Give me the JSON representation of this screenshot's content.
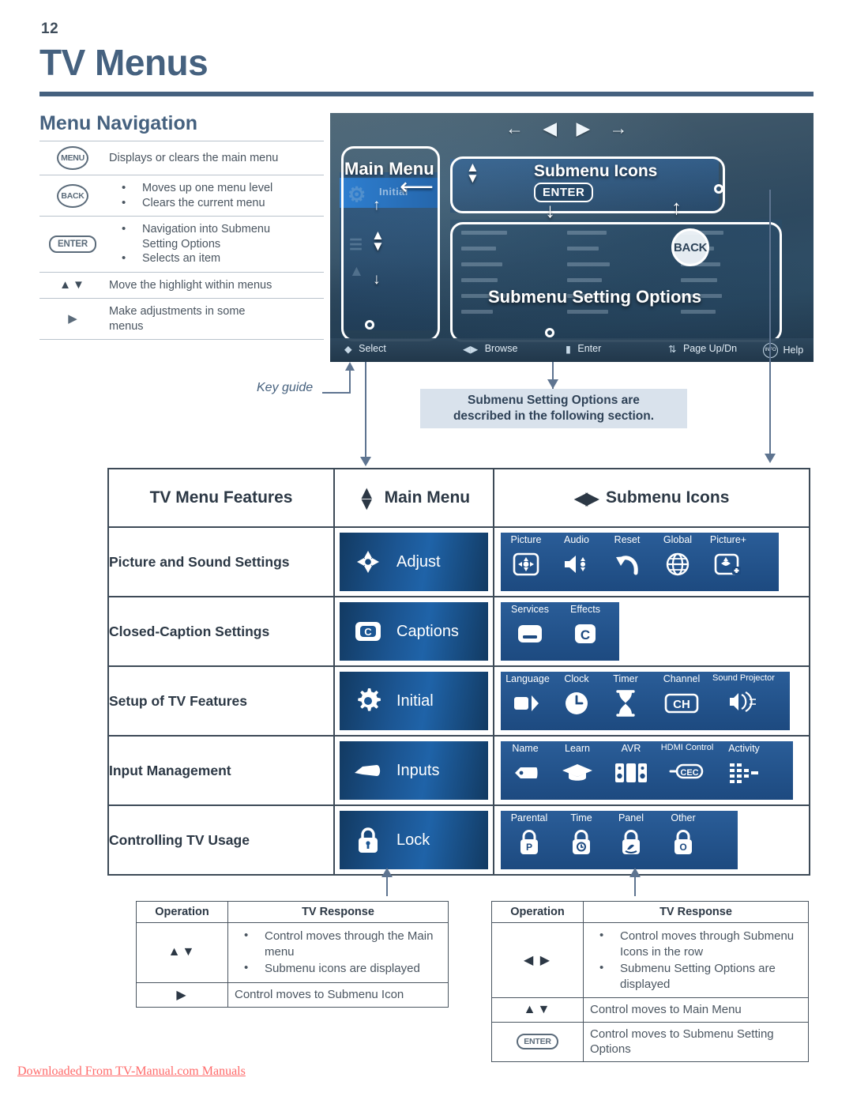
{
  "page": {
    "number": "12",
    "title": "TV Menus"
  },
  "nav": {
    "heading": "Menu Navigation",
    "rows": [
      {
        "key": "MENU",
        "key_type": "round",
        "lines": [
          "Displays or clears the main menu"
        ],
        "bulleted": false
      },
      {
        "key": "BACK",
        "key_type": "round",
        "lines": [
          "Moves up one menu level",
          "Clears the current menu"
        ],
        "bulleted": true
      },
      {
        "key": "ENTER",
        "key_type": "pill",
        "lines": [
          "Navigation into Submenu",
          "Setting Options",
          "Selects an item"
        ],
        "bulleted": true
      },
      {
        "key": "▲▼",
        "key_type": "glyph",
        "lines": [
          "Move the highlight within menus"
        ],
        "bulleted": false
      },
      {
        "key": "▶",
        "key_type": "glyph",
        "lines": [
          "Make adjustments in some",
          "menus"
        ],
        "bulleted": false
      }
    ]
  },
  "tv": {
    "top_arrows": "← ◀  ▶ →",
    "callouts": {
      "main_menu": "Main Menu",
      "submenu_icons": "Submenu Icons",
      "submenu_setting_options": "Submenu Setting Options"
    },
    "badges": {
      "enter": "ENTER",
      "back": "BACK"
    },
    "ghost_menu_label": "Initial",
    "keyguide": [
      {
        "label": "Select"
      },
      {
        "label": "Browse"
      },
      {
        "label": "Enter"
      },
      {
        "label": "Page Up/Dn"
      },
      {
        "label": "Help"
      }
    ]
  },
  "annotations": {
    "key_guide": "Key guide",
    "note_line1": "Submenu Setting Options are",
    "note_line2": "described in the following section."
  },
  "feature_table": {
    "headers": {
      "features": "TV Menu Features",
      "main_menu": "Main Menu",
      "submenu_icons": "Submenu Icons"
    },
    "rows": [
      {
        "feature": "Picture and Sound Settings",
        "main": {
          "label": "Adjust",
          "icon": "dpad-icon"
        },
        "submenu": [
          {
            "caption": "Picture",
            "icon": "picture-icon"
          },
          {
            "caption": "Audio",
            "icon": "speaker-icon"
          },
          {
            "caption": "Reset",
            "icon": "undo-arrow-icon"
          },
          {
            "caption": "Global",
            "icon": "globe-icon"
          },
          {
            "caption": "Picture+",
            "icon": "picture-plus-icon"
          }
        ]
      },
      {
        "feature": "Closed-Caption Settings",
        "main": {
          "label": "Captions",
          "icon": "caption-c-icon"
        },
        "submenu": [
          {
            "caption": "Services",
            "icon": "caption-box-icon"
          },
          {
            "caption": "Effects",
            "icon": "letter-c-icon"
          }
        ]
      },
      {
        "feature": "Setup of TV Features",
        "main": {
          "label": "Initial",
          "icon": "gear-icon"
        },
        "submenu": [
          {
            "caption": "Language",
            "icon": "language-speech-icon"
          },
          {
            "caption": "Clock",
            "icon": "clock-icon"
          },
          {
            "caption": "Timer",
            "icon": "hourglass-icon"
          },
          {
            "caption": "Channel",
            "icon": "channel-ch-icon"
          },
          {
            "caption": "Sound Projector",
            "icon": "sound-projector-icon"
          }
        ]
      },
      {
        "feature": "Input Management",
        "main": {
          "label": "Inputs",
          "icon": "plug-icon"
        },
        "submenu": [
          {
            "caption": "Name",
            "icon": "tag-icon"
          },
          {
            "caption": "Learn",
            "icon": "graduation-cap-icon"
          },
          {
            "caption": "AVR",
            "icon": "avr-speakers-icon"
          },
          {
            "caption": "HDMI Control",
            "icon": "cec-plug-icon"
          },
          {
            "caption": "Activity",
            "icon": "activity-bars-icon"
          }
        ]
      },
      {
        "feature": "Controlling TV Usage",
        "main": {
          "label": "Lock",
          "icon": "padlock-icon"
        },
        "submenu": [
          {
            "caption": "Parental",
            "icon": "lock-p-icon"
          },
          {
            "caption": "Time",
            "icon": "lock-clock-icon"
          },
          {
            "caption": "Panel",
            "icon": "lock-hand-icon"
          },
          {
            "caption": "Other",
            "icon": "lock-o-icon"
          }
        ]
      }
    ]
  },
  "op_table_left": {
    "headers": {
      "operation": "Operation",
      "response": "TV Response"
    },
    "rows": [
      {
        "op": "▲▼",
        "bulleted": true,
        "lines": [
          "Control moves through the Main menu",
          "Submenu icons are displayed"
        ]
      },
      {
        "op": "▶",
        "bulleted": false,
        "lines": [
          "Control moves to Submenu Icon"
        ]
      }
    ]
  },
  "op_table_right": {
    "headers": {
      "operation": "Operation",
      "response": "TV Response"
    },
    "rows": [
      {
        "op": "◀ ▶",
        "bulleted": true,
        "lines": [
          "Control moves through Submenu Icons in the row",
          "Submenu Setting Options are displayed"
        ]
      },
      {
        "op": "▲▼",
        "bulleted": false,
        "lines": [
          "Control moves to Main Menu"
        ]
      },
      {
        "op": "ENTER",
        "op_type": "pill",
        "bulleted": false,
        "lines": [
          "Control moves to Submenu Setting Options"
        ]
      }
    ]
  },
  "footer": {
    "text": "Downloaded From TV-Manual.com Manuals"
  },
  "colors": {
    "brand_blue": "#45617f",
    "panel_blue": "#1d4a80",
    "chip_blue": "#1c5693",
    "note_bg": "#d9e2ec",
    "footer_red": "#ff6a6a"
  }
}
